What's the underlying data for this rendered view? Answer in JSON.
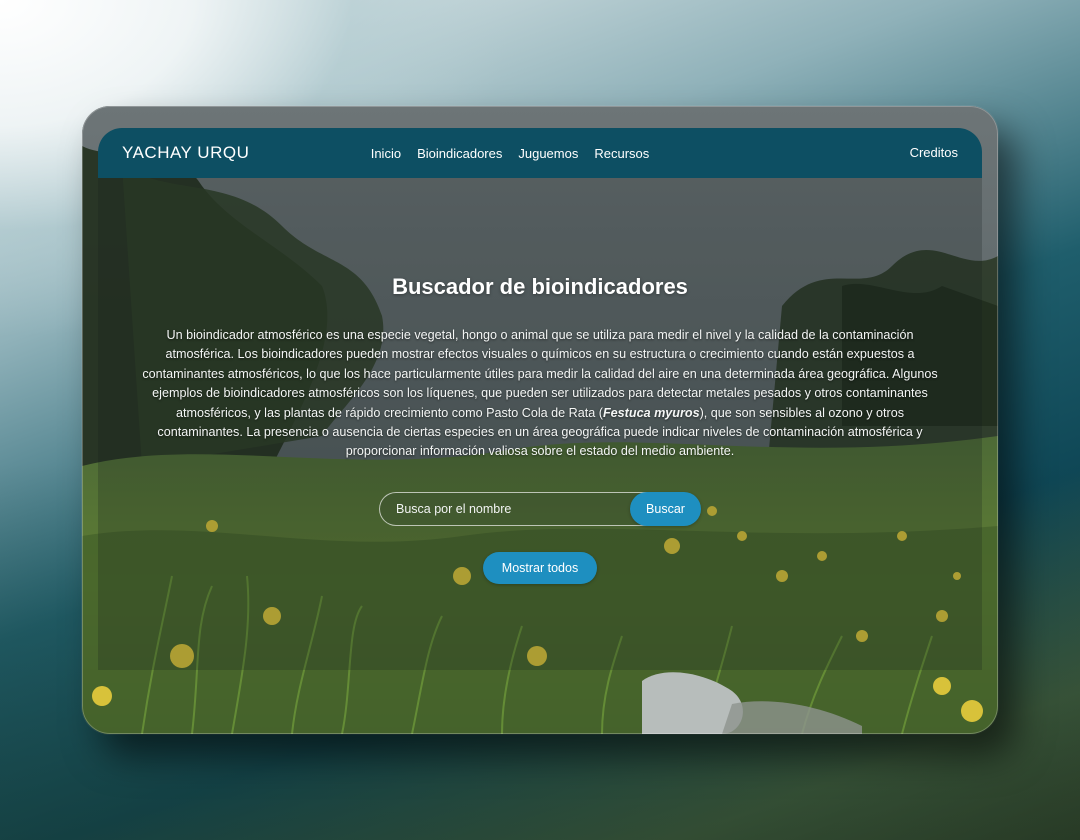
{
  "navbar": {
    "brand": "YACHAY URQU",
    "links": [
      {
        "label": "Inicio"
      },
      {
        "label": "Bioindicadores"
      },
      {
        "label": "Juguemos"
      },
      {
        "label": "Recursos"
      }
    ],
    "right_link": "Creditos"
  },
  "hero": {
    "title": "Buscador de bioindicadores",
    "description_before": "Un bioindicador atmosférico es una especie vegetal, hongo o animal que se utiliza para medir el nivel y la calidad de la contaminación atmosférica. Los bioindicadores pueden mostrar efectos visuales o químicos en su estructura o crecimiento cuando están expuestos a contaminantes atmosféricos, lo que los hace particularmente útiles para medir la calidad del aire en una determinada área geográfica. Algunos ejemplos de bioindicadores atmosféricos son los líquenes, que pueden ser utilizados para detectar metales pesados y otros contaminantes atmosféricos, y las plantas de rápido crecimiento como Pasto Cola de Rata (",
    "description_italic": "Festuca myuros",
    "description_after": "), que son sensibles al ozono y otros contaminantes. La presencia o ausencia de ciertas especies en un área geográfica puede indicar niveles de contaminación atmosférica y proporcionar información valiosa sobre el estado del medio ambiente."
  },
  "search": {
    "placeholder": "Busca por el nombre",
    "value": "",
    "button_label": "Buscar"
  },
  "show_all_label": "Mostrar todos",
  "colors": {
    "navbar": "#0d4f63",
    "button": "#1e8fc0",
    "text": "#ffffff"
  }
}
